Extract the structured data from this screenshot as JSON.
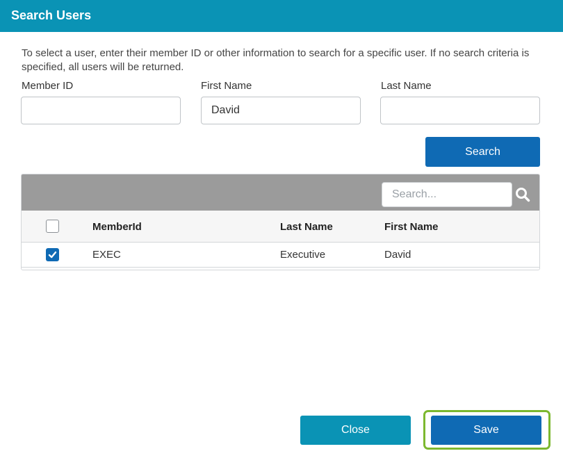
{
  "dialog": {
    "title": "Search Users",
    "description": "To select a user, enter their member ID or other information to search for a specific user.  If no search criteria is specified, all users will be returned."
  },
  "form": {
    "member_id": {
      "label": "Member ID",
      "value": ""
    },
    "first_name": {
      "label": "First Name",
      "value": "David"
    },
    "last_name": {
      "label": "Last Name",
      "value": ""
    },
    "search_label": "Search"
  },
  "grid": {
    "search_placeholder": "Search...",
    "columns": [
      "MemberId",
      "Last Name",
      "First Name"
    ],
    "rows": [
      {
        "checked": true,
        "member_id": "EXEC",
        "last_name": "Executive",
        "first_name": "David"
      }
    ]
  },
  "footer": {
    "close_label": "Close",
    "save_label": "Save"
  },
  "colors": {
    "header": "#0a93b5",
    "primary": "#0f6ab4",
    "focus_ring": "#7cb82f",
    "grid_toolbar": "#9b9b9b"
  }
}
